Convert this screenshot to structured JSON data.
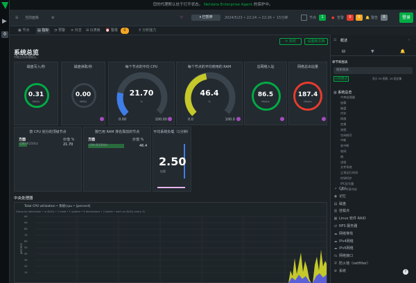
{
  "banner": {
    "text": "您的代理默认处于打开状态。",
    "link": "Netdata Enterprise Agent",
    "suffix": "的保护中。"
  },
  "topbar": {
    "menu_label": "当前面板",
    "time_chip": "已暂停",
    "date_range": "2024/5/23 • 22:24 → 22:26 •",
    "duration": "15分钟",
    "status_items": [
      {
        "label": "节点",
        "count": "1",
        "color": "#00ab44"
      },
      {
        "label": "告警",
        "count": "0",
        "color": "#e63c2d"
      },
      {
        "label": "",
        "count": "0",
        "color": "#f5a623"
      },
      {
        "label": "警告",
        "count": "0",
        "color": "#6e7a82"
      }
    ],
    "signin": "登录"
  },
  "nav": {
    "tabs": [
      "节点",
      "指标",
      "预警",
      "日志",
      "仪表板",
      "警报",
      "分析能力"
    ],
    "active": 1,
    "alert_count": "0"
  },
  "section": {
    "title": "系统总览",
    "subtitle": "中概主机系统概况。",
    "btn_live": "实时",
    "btn_settings": "设置和文档"
  },
  "gauges_small": [
    {
      "title": "磁盘写入/秒",
      "value": "0.31",
      "unit": "MiB/s",
      "color": "#00ab44"
    },
    {
      "title": "磁盘读取/秒",
      "value": "0.00",
      "unit": "MiB/s",
      "color": "#00ab44"
    }
  ],
  "gauges_big": [
    {
      "title": "每个节点的平均 CPU",
      "value": "21.70",
      "unit": "%",
      "min": "0.00",
      "max": "100.00",
      "fraction": 0.217,
      "color": "#3f7ee8"
    },
    {
      "title": "每个节点的平均使用的 RAM",
      "value": "46.4",
      "unit": "%",
      "min": "0.0",
      "max": "100.0",
      "fraction": 0.464,
      "color": "#c5c92a"
    }
  ],
  "gauges_net": [
    {
      "title": "总网络入站",
      "value": "86.5",
      "unit": "Mbit/s",
      "color": "#00ab44"
    },
    {
      "title": "网络总出站量",
      "value": "187.4",
      "unit": "Mbit/s",
      "color": "#e63c2d"
    }
  ],
  "tables": [
    {
      "title": "按 CPU 划分的顶级节点",
      "col1": "方面",
      "col2": "价值 %",
      "row": "CNI-R35f4d",
      "val": "21.70"
    },
    {
      "title": "按已用 RAM 排名靠前的节点",
      "col1": "方面",
      "col2": "价值 %",
      "row": "CNI-R35f4d",
      "val": "46.4"
    }
  ],
  "load": {
    "title": "平均系统负载（1分钟）",
    "value": "2.50",
    "unit": "加载"
  },
  "cpu_section": {
    "title": "中央处理器",
    "chart_title": "Total CPU utilization • 系统(cpu • [percent]",
    "filters": "Group by dimension  •  in AVG()  •  1 node  •  1 system  •  9 dimensions  •  2 labels  •  each as AVG() every 1s",
    "y_label": "percent",
    "y_ticks": [
      "All",
      "90",
      "80",
      "70",
      "60",
      "50",
      "40",
      "30",
      "20",
      "10"
    ],
    "chart_data": {
      "type": "area",
      "note": ""
    }
  },
  "right_panel": {
    "title": "概述",
    "search_placeholder": "搜索图表",
    "filter_label": "分组模式",
    "stats": "显示 58 图表, 28 超出集",
    "section": "系统总览",
    "sub_items": [
      "中央处理器",
      "加载",
      "磁盘",
      "内存",
      "网络",
      "交换",
      "流程",
      "空闲耗尽",
      "中断",
      "软中断",
      "软网",
      "熵",
      "进程",
      "文件系统",
      "正常运行时间",
      "时钟同步",
      "IPC信号量",
      "ipc 共享内存"
    ],
    "groups": [
      {
        "icon": "cpu-icon",
        "label": "CPU"
      },
      {
        "icon": "memory-icon",
        "label": "记忆"
      },
      {
        "icon": "disk-icon",
        "label": "磁盘"
      },
      {
        "icon": "mounts-icon",
        "label": "挂载点"
      },
      {
        "icon": "raid-icon",
        "label": "Linux 软件 RAID"
      },
      {
        "icon": "nfs-icon",
        "label": "NFS 服务器"
      },
      {
        "icon": "network-icon",
        "label": "网络堆栈"
      },
      {
        "icon": "ipv4-icon",
        "label": "IPv4网络"
      },
      {
        "icon": "ipv6-icon",
        "label": "IPv6网络"
      },
      {
        "icon": "interface-icon",
        "label": "网络接口"
      },
      {
        "icon": "firewall-icon",
        "label": "防火墙（netfilter）"
      },
      {
        "icon": "systemd-icon",
        "label": "系统"
      }
    ]
  }
}
